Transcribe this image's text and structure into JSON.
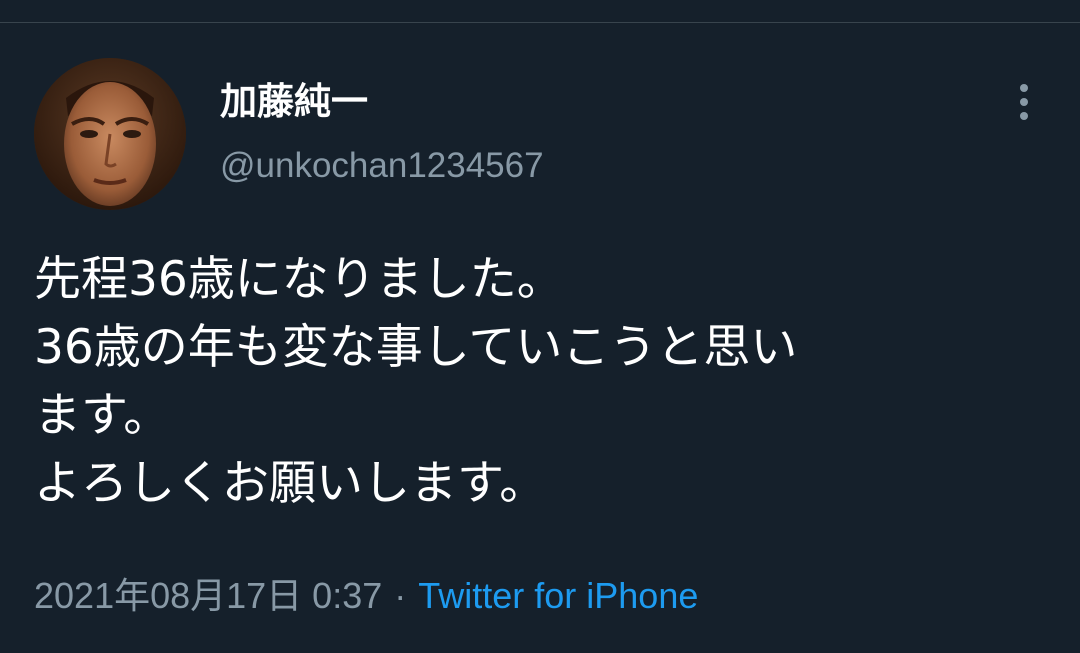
{
  "tweet": {
    "author": {
      "display_name": "加藤純一",
      "handle": "@unkochan1234567",
      "avatar_icon": "user-avatar-portrait"
    },
    "menu_icon": "more-vertical-icon",
    "text_lines": [
      "先程36歳になりました。",
      "36歳の年も変な事していこうと思い",
      "ます。",
      "よろしくお願いします。"
    ],
    "timestamp": "2021年08月17日 0:37",
    "separator": "·",
    "source": "Twitter for iPhone"
  },
  "colors": {
    "background": "#15202b",
    "divider": "#38444d",
    "primary_text": "#ffffff",
    "secondary_text": "#8899a6",
    "link": "#1d9bf0"
  }
}
